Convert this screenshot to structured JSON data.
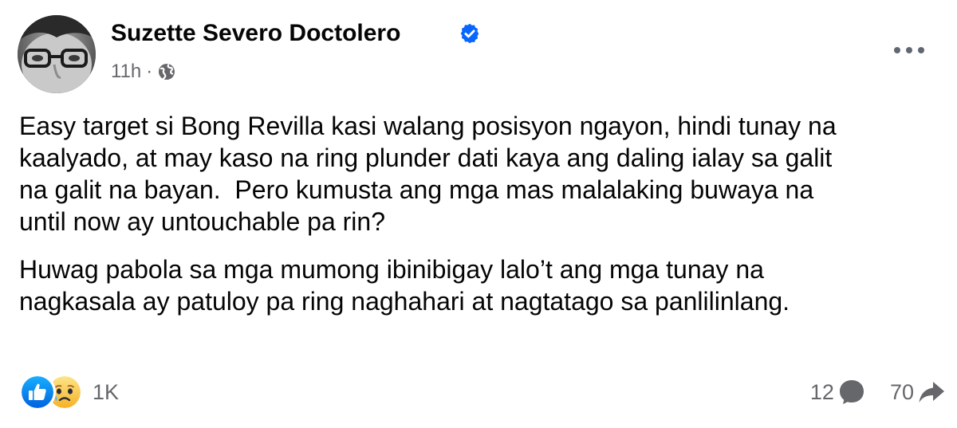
{
  "author": {
    "name": "Suzette Severo Doctolero",
    "verified": true
  },
  "meta": {
    "time": "11h",
    "separator": "·",
    "audience_icon": "globe-icon"
  },
  "post": {
    "paragraphs": [
      "Easy target si Bong Revilla kasi walang posisyon ngayon, hindi tunay na\nkaalyado, at may kaso na ring plunder dati kaya ang daling ialay sa galit\nna galit na bayan.  Pero kumusta ang mga mas malalaking buwaya na\nuntil now ay untouchable pa rin?",
      "Huwag pabola sa mga mumong ibinibigay lalo’t ang mga tunay na\nnagkasala ay patuloy pa ring naghahari at nagtatago sa panlilinlang."
    ]
  },
  "footer": {
    "reaction_icons": [
      "like-icon",
      "sad-icon"
    ],
    "reaction_count": "1K",
    "comment_count": "12",
    "share_count": "70"
  },
  "colors": {
    "text": "#050505",
    "secondary": "#65676b",
    "verified_blue": "#0866ff",
    "like_blue": "#1877f2",
    "sad_yellow": "#f7b125"
  }
}
